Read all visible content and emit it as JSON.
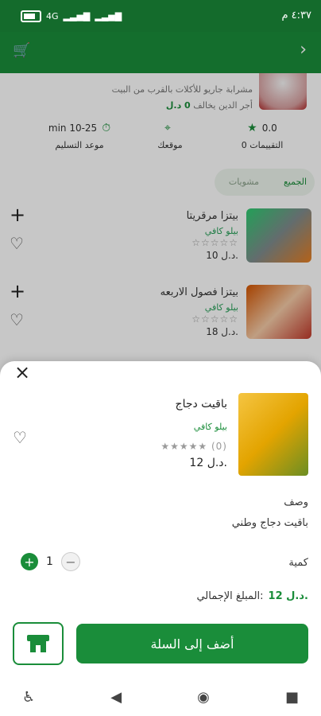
{
  "status": {
    "time": "٤:٣٧ م",
    "network_label": "4G"
  },
  "topbar": {
    "cart_icon": "cart-icon",
    "back_icon": "chevron-right-icon"
  },
  "store": {
    "description": "مشرابة جاريو للأكلات بالقرب من البيت",
    "delivery_prefix": "أجر الدين يخالف",
    "delivery_value": "0 د.ل",
    "stats": [
      {
        "top": "0.0",
        "bottom": "0 التقييمات",
        "icon": "star-icon"
      },
      {
        "top": "",
        "bottom": "موقعك",
        "icon": "location-icon"
      },
      {
        "top": "min 10-25",
        "bottom": "موعد التسليم",
        "icon": "timer-icon"
      }
    ],
    "tabs": [
      {
        "label": "الجميع"
      },
      {
        "label": "مشويات"
      }
    ],
    "items": [
      {
        "title": "بيتزا مرقريتا",
        "subtitle": "بيلو كافي",
        "stars": "☆☆☆☆☆",
        "price": "10 د.ل."
      },
      {
        "title": "بيتزا فصول الاربعه",
        "subtitle": "بيلو كافي",
        "stars": "☆☆☆☆☆",
        "price": "18 د.ل."
      }
    ]
  },
  "product": {
    "title": "باقيت دجاج",
    "brand": "بيلو كافي",
    "stars": "★★★★★ (0)",
    "price": "12 د.ل.",
    "description_label": "وصف",
    "description_text": "باقيت دجاج وطني",
    "quantity_label": "كمية",
    "quantity_value": "1",
    "total_label": "المبلغ الإجمالي:",
    "total_value": "12 د.ل.",
    "add_to_cart_label": "أضف إلى السلة"
  },
  "navbar": {
    "items": [
      "accessibility-icon",
      "back-triangle-icon",
      "home-circle-icon",
      "recent-square-icon"
    ]
  }
}
